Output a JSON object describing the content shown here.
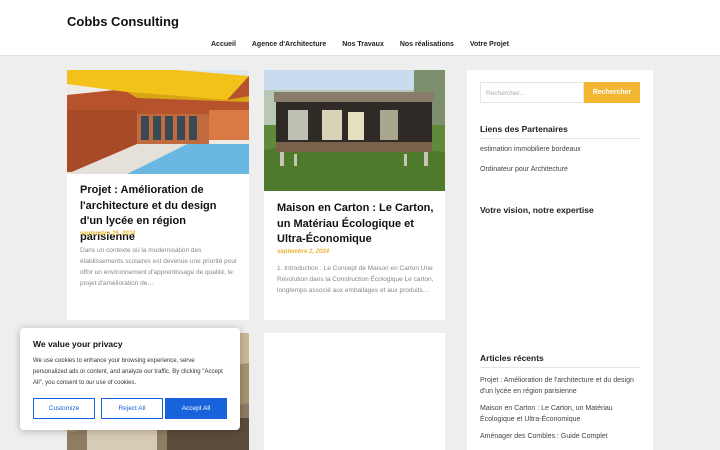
{
  "header": {
    "site_title": "Cobbs Consulting",
    "nav": [
      "Accueil",
      "Agence d'Architecture",
      "Nos Travaux",
      "Nos réalisations",
      "Votre Projet"
    ]
  },
  "posts": [
    {
      "title": "Projet : Amélioration de l'architecture et du design d'un lycée en région parisienne",
      "date": "septembre 25, 2024",
      "excerpt": "Dans un contexte où la modernisation des établissements scolaires est devenue une priorité pour offrir un environnement d'apprentissage de qualité, le projet d'amélioration de…"
    },
    {
      "title": "Maison en Carton : Le Carton, un Matériau Écologique et Ultra-Économique",
      "date": "septembre 2, 2024",
      "excerpt": "1. Introduction : Le Concept de Maison en Carton Une Révolution dans la Construction Écologique Le carton, longtemps associé aux emballages et aux produits…"
    }
  ],
  "sidebar": {
    "search_placeholder": "Rechercher…",
    "search_button": "Rechercher",
    "partners_title": "Liens des Partenaires",
    "partners": [
      "estimation immobiliere bordeaux",
      "Ordinateur pour Architecture"
    ],
    "vision_title": "Votre vision, notre expertise",
    "recent_title": "Articles récents",
    "recent": [
      "Projet : Amélioration de l'architecture et du design d'un lycée en région parisienne",
      "Maison en Carton : Le Carton, un Matériau Écologique et Ultra-Économique",
      "Aménager des Combles : Guide Complet"
    ]
  },
  "cookie": {
    "title": "We value your privacy",
    "text": "We use cookies to enhance your browsing experience, serve personalized ads or content, and analyze our traffic. By clicking \"Accept All\", you consent to our use of cookies.",
    "customize": "Customize",
    "reject": "Reject All",
    "accept": "Accept All"
  },
  "colors": {
    "accent": "#f2b632",
    "date": "#e9b437",
    "cookie_blue": "#1863dc"
  }
}
